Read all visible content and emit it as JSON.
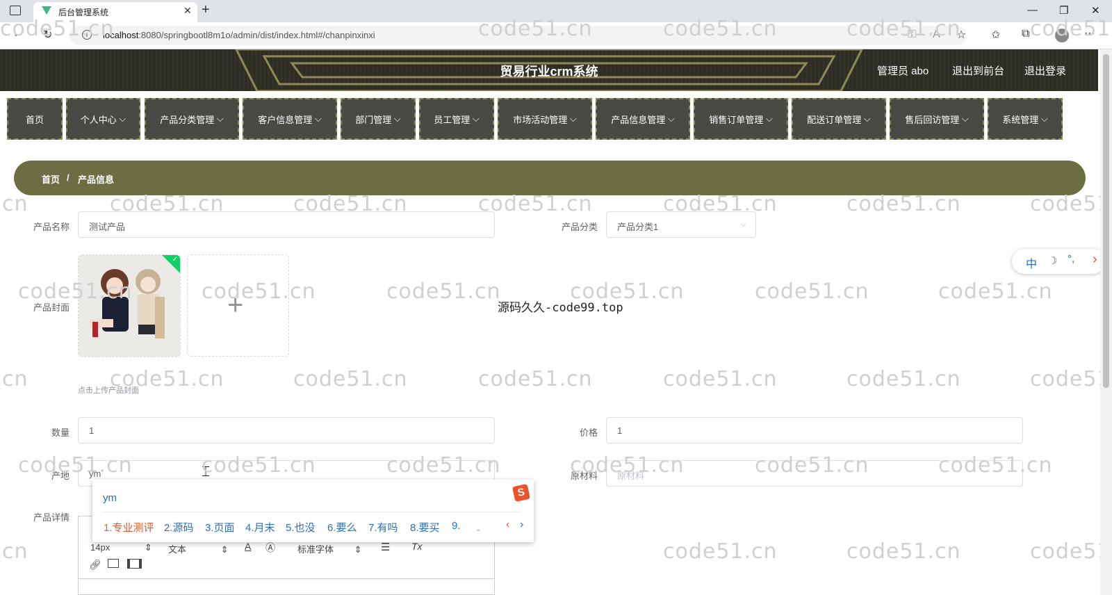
{
  "browser": {
    "tab_title": "后台管理系统",
    "url_host": "localhost",
    "url_rest": ":8080/springbootl8m1o/admin/dist/index.html#/chanpinxinxi"
  },
  "header": {
    "title": "贸易行业crm系统",
    "user": "管理员 abo",
    "to_front": "退出到前台",
    "logout": "退出登录"
  },
  "menu": [
    "首页",
    "个人中心",
    "产品分类管理",
    "客户信息管理",
    "部门管理",
    "员工管理",
    "市场活动管理",
    "产品信息管理",
    "销售订单管理",
    "配送订单管理",
    "售后回访管理",
    "系统管理"
  ],
  "breadcrumb": {
    "home": "首页",
    "sep": "/",
    "current": "产品信息"
  },
  "form": {
    "name_label": "产品名称",
    "name_value": "测试产品",
    "category_label": "产品分类",
    "category_value": "产品分类1",
    "cover_label": "产品封面",
    "cover_hint": "点击上传产品封面",
    "qty_label": "数量",
    "qty_value": "1",
    "price_label": "价格",
    "price_value": "1",
    "origin_label": "产地",
    "origin_value": "ym",
    "material_label": "原材料",
    "material_placeholder": "原材料",
    "detail_label": "产品详情"
  },
  "editor": {
    "font_size": "14px",
    "text_type": "文本",
    "font_family": "标准字体"
  },
  "ime": {
    "bar": [
      "中",
      "☽",
      "°,",
      "›"
    ],
    "input": "ym",
    "candidates": [
      "1.专业测评",
      "2.源码",
      "3.页面",
      "4.月末",
      "5.也没",
      "6.要么",
      "7.有吗",
      "8.要买",
      "9."
    ]
  },
  "watermarks": {
    "main": "code51.cn",
    "center": "源码久久-code99.top"
  }
}
